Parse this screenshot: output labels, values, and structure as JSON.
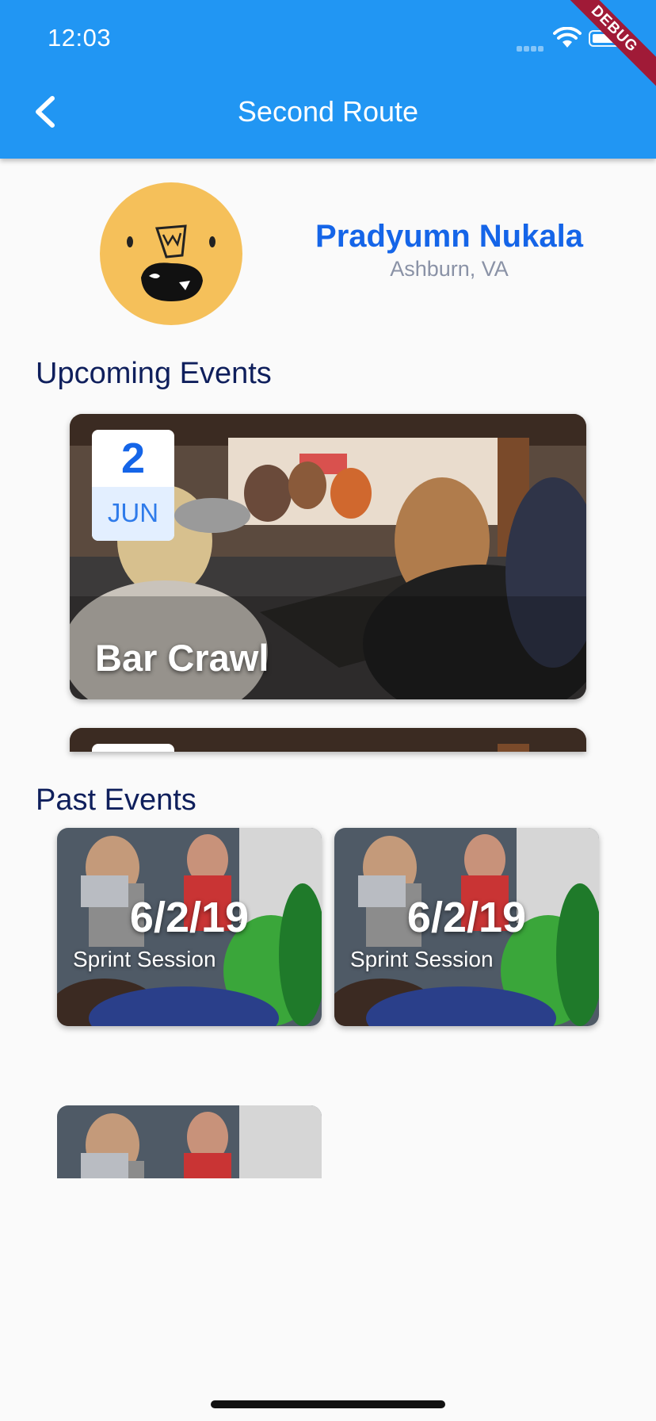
{
  "status_bar": {
    "time": "12:03"
  },
  "debug_banner": "DEBUG",
  "app_bar": {
    "title": "Second Route",
    "back_icon": "chevron-left-icon",
    "color": "#2196f3"
  },
  "profile": {
    "name": "Pradyumn Nukala",
    "location": "Ashburn, VA",
    "avatar_color": "#f5c05a"
  },
  "upcoming": {
    "title": "Upcoming Events",
    "events": [
      {
        "day": "2",
        "month": "JUN",
        "name": "Bar Crawl"
      },
      {
        "day": "",
        "month": "",
        "name": ""
      }
    ]
  },
  "past": {
    "title": "Past Events",
    "events": [
      {
        "date": "6/2/19",
        "name": "Sprint Session"
      },
      {
        "date": "6/2/19",
        "name": "Sprint Session"
      },
      {
        "date": "",
        "name": ""
      }
    ]
  },
  "colors": {
    "accent": "#1565e8",
    "heading": "#0f1f5c",
    "background": "#fafafa"
  }
}
